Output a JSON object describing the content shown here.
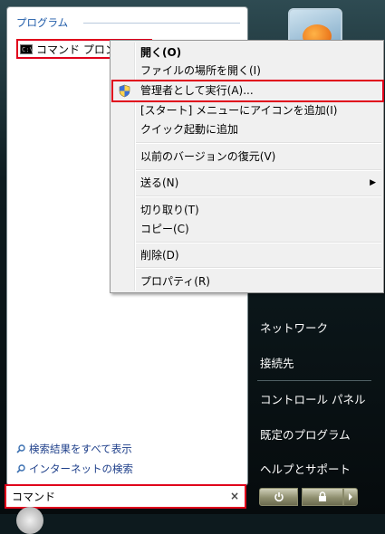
{
  "left_panel": {
    "section_header": "プログラム",
    "program_item": "コマンド プロンプト",
    "program_icon_text": "C:\\",
    "search_all_link": "検索結果をすべて表示",
    "internet_search_link": "インターネットの検索"
  },
  "search": {
    "value": "コマンド",
    "clear_glyph": "×"
  },
  "right_panel": {
    "items": [
      "ネットワーク",
      "接続先",
      "コントロール パネル",
      "既定のプログラム",
      "ヘルプとサポート"
    ]
  },
  "context_menu": {
    "open": "開く(O)",
    "open_location": "ファイルの場所を開く(I)",
    "run_as_admin": "管理者として実行(A)...",
    "pin_start": "[スタート] メニューにアイコンを追加(I)",
    "add_quick_launch": "クイック起動に追加",
    "restore_versions": "以前のバージョンの復元(V)",
    "send_to": "送る(N)",
    "cut": "切り取り(T)",
    "copy": "コピー(C)",
    "delete": "削除(D)",
    "properties": "プロパティ(R)",
    "submenu_arrow": "▶"
  },
  "colors": {
    "highlight_outline": "#e0001b",
    "link_blue": "#1e3f8a",
    "menu_bg": "#f0f0f0"
  },
  "icons": [
    "console-icon",
    "magnifier-icon",
    "shield-icon",
    "power-icon",
    "lock-icon",
    "arrow-right-icon",
    "user-picture-icon"
  ]
}
